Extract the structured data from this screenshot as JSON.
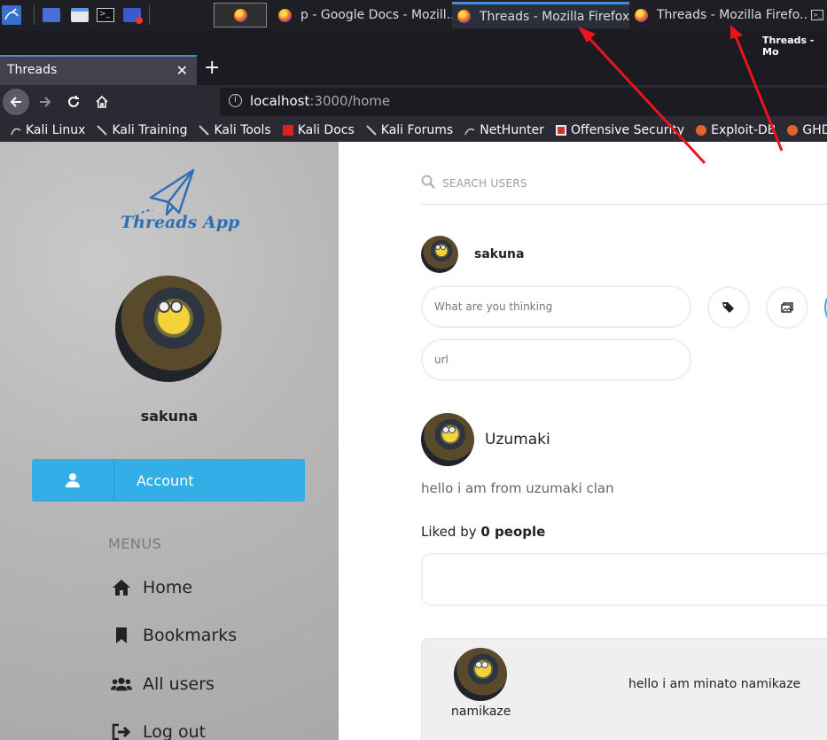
{
  "taskbar": {
    "tasks": [
      {
        "title": "p - Google Docs - Mozill..."
      },
      {
        "title": "Threads - Mozilla Firefox"
      },
      {
        "title": "Threads - Mozilla Firefo..."
      }
    ],
    "window_title_fragment": "Threads - Mo"
  },
  "browser": {
    "tab_title": "Threads",
    "url_host": "localhost",
    "url_path": ":3000/home",
    "bookmarks": [
      "Kali Linux",
      "Kali Training",
      "Kali Tools",
      "Kali Docs",
      "Kali Forums",
      "NetHunter",
      "Offensive Security",
      "Exploit-DB",
      "GHD"
    ]
  },
  "sidebar": {
    "logo_text": "Threads App",
    "username": "sakuna",
    "account_label": "Account",
    "menus_label": "MENUS",
    "menu": [
      {
        "label": "Home",
        "icon": "home-icon"
      },
      {
        "label": "Bookmarks",
        "icon": "bookmark-icon"
      },
      {
        "label": "All users",
        "icon": "users-icon"
      },
      {
        "label": "Log out",
        "icon": "logout-icon"
      }
    ]
  },
  "main": {
    "search_placeholder": "SEARCH USERS",
    "current_user": "sakuna",
    "thought_placeholder": "What are you thinking",
    "url_placeholder": "url",
    "post": {
      "author": "Uzumaki",
      "text": "hello i am from uzumaki clan",
      "liked_prefix": "Liked by",
      "liked_count": "0 people"
    },
    "reply": {
      "author": "namikaze",
      "text": "hello i am minato namikaze"
    }
  },
  "colors": {
    "accent": "#33aee6",
    "annotation_arrow": "#e8141e",
    "firefox_tab_accent": "#3d8ee0"
  }
}
